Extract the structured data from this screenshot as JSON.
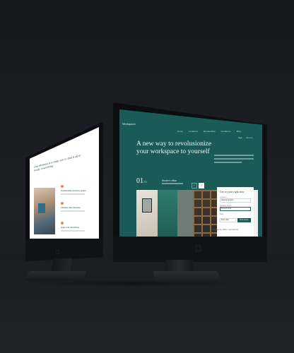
{
  "left_screen": {
    "title": "Our mission is to help you to find it all in ready coworking",
    "items": [
      {
        "title": "Sustainable working space"
      },
      {
        "title": "Flexible Membership"
      },
      {
        "title": "High-end furnishing"
      }
    ]
  },
  "right_screen": {
    "logo": "Workspacer",
    "nav": [
      "Home",
      "Locations",
      "Membership",
      "Contact us",
      "Blog"
    ],
    "login": [
      "Sign",
      "Join us"
    ],
    "headline": "A new way to revolusionize your workspace to yourself",
    "counter": "01",
    "counter_total": "/03",
    "slide_title": "Modern office",
    "arrows": [
      "‹",
      "›"
    ],
    "form": {
      "title": "Get to your right now",
      "fields": [
        {
          "label": "Location",
          "value": "Jakarta Selatan"
        },
        {
          "label": "Working space",
          "value": "Shared desk"
        },
        {
          "label": "Date",
          "value": "Start date"
        }
      ],
      "button": "Find space"
    },
    "chin_text": "Trusted by 500+ companies"
  },
  "colors": {
    "accent": "#1b5b57",
    "highlight": "#e08a5a"
  },
  "icons": {
    "left_logo": "apple-icon",
    "right_logo": "apple-icon"
  }
}
